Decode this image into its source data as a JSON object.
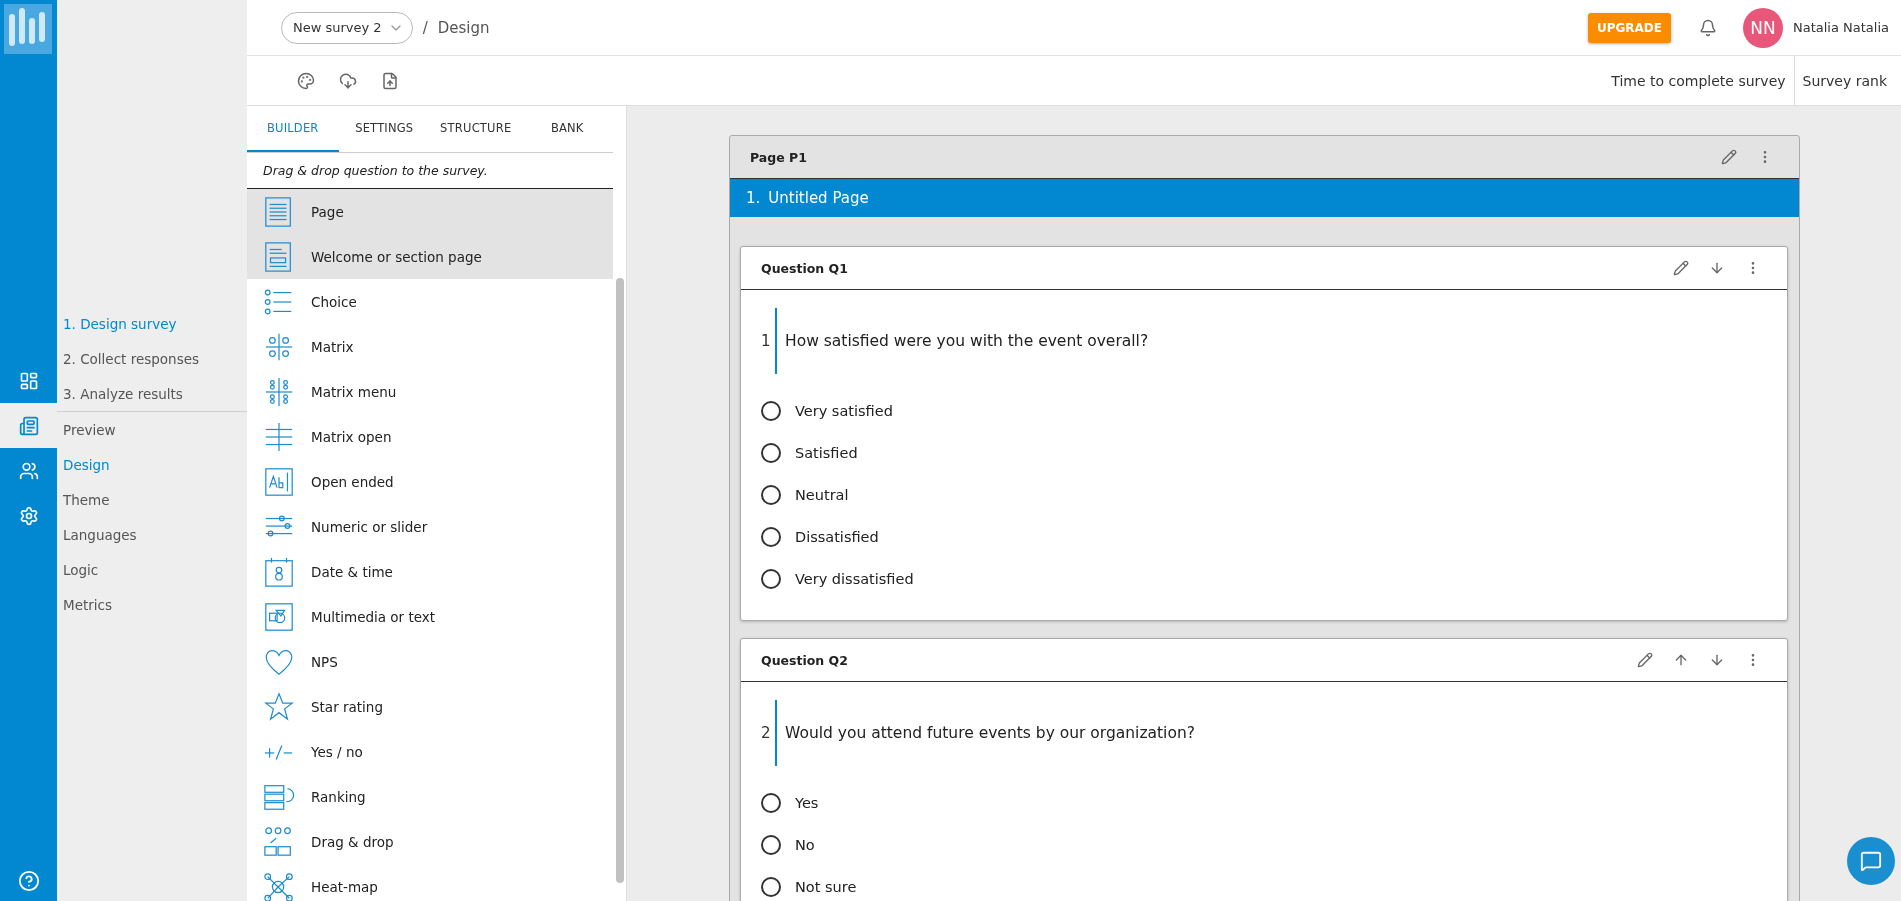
{
  "top_bar": {
    "survey_name": "New survey 2",
    "separator": "/",
    "breadcrumb": "Design",
    "upgrade_button": "UPGRADE",
    "avatar_initials": "NN",
    "user_name": "Natalia Natalia"
  },
  "rail_items": [
    {
      "selected": false
    },
    {
      "selected": true
    },
    {
      "selected": false
    },
    {
      "selected": false
    }
  ],
  "steps": [
    {
      "label": "1. Design survey",
      "selected": true
    },
    {
      "label": "2. Collect responses",
      "selected": false
    },
    {
      "label": "3. Analyze results",
      "selected": false
    }
  ],
  "nav_items": [
    {
      "label": "Preview",
      "selected": false
    },
    {
      "label": "Design",
      "selected": true
    },
    {
      "label": "Theme",
      "selected": false
    },
    {
      "label": "Languages",
      "selected": false
    },
    {
      "label": "Logic",
      "selected": false
    },
    {
      "label": "Metrics",
      "selected": false
    }
  ],
  "toolbar": {
    "metrics": [
      "Time to complete survey",
      "Survey rank"
    ]
  },
  "tabs": [
    {
      "label": "BUILDER",
      "selected": true
    },
    {
      "label": "SETTINGS",
      "selected": false
    },
    {
      "label": "STRUCTURE",
      "selected": false
    },
    {
      "label": "BANK",
      "selected": false
    }
  ],
  "builder": {
    "hint": "Drag & drop question to the survey.",
    "items": [
      {
        "label": "Page",
        "selected": true
      },
      {
        "label": "Welcome or section page",
        "selected": true
      },
      {
        "label": "Choice",
        "selected": false
      },
      {
        "label": "Matrix",
        "selected": false
      },
      {
        "label": "Matrix menu",
        "selected": false
      },
      {
        "label": "Matrix open",
        "selected": false
      },
      {
        "label": "Open ended",
        "selected": false
      },
      {
        "label": "Numeric or slider",
        "selected": false
      },
      {
        "label": "Date & time",
        "selected": false
      },
      {
        "label": "Multimedia or text",
        "selected": false
      },
      {
        "label": "NPS",
        "selected": false
      },
      {
        "label": "Star rating",
        "selected": false
      },
      {
        "label": "Yes / no",
        "selected": false
      },
      {
        "label": "Ranking",
        "selected": false
      },
      {
        "label": "Drag & drop",
        "selected": false
      },
      {
        "label": "Heat-map",
        "selected": false
      }
    ]
  },
  "page": {
    "header": "Page P1",
    "title_number": "1.",
    "title": "Untitled Page",
    "questions": [
      {
        "header": "Question Q1",
        "number": "1",
        "text": "How satisfied were you with the event overall?",
        "can_move_up": false,
        "can_move_down": true,
        "options": [
          {
            "label": "Very satisfied",
            "selected": false
          },
          {
            "label": "Satisfied",
            "selected": false
          },
          {
            "label": "Neutral",
            "selected": false
          },
          {
            "label": "Dissatisfied",
            "selected": false
          },
          {
            "label": "Very dissatisfied",
            "selected": false
          }
        ]
      },
      {
        "header": "Question Q2",
        "number": "2",
        "text": "Would you attend future events by our organization?",
        "can_move_up": true,
        "can_move_down": true,
        "options": [
          {
            "label": "Yes",
            "selected": false
          },
          {
            "label": "No",
            "selected": false
          },
          {
            "label": "Not sure",
            "selected": false
          }
        ]
      }
    ]
  }
}
